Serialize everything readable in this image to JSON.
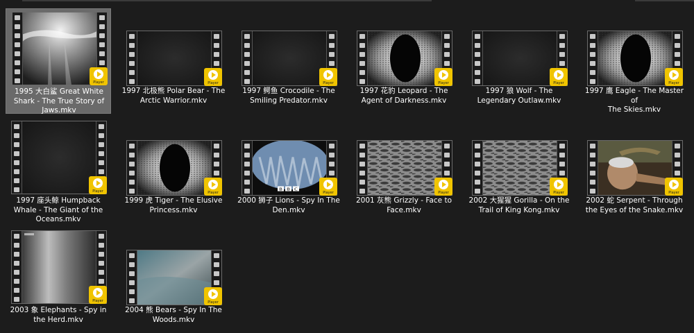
{
  "badge_text": "Player",
  "files": [
    {
      "name": "1995 大白鲨 Great White Shark - The True Story of Jaws.mkv",
      "lines": [
        "1995 大白鲨 Great White",
        "Shark - The True Story of",
        "Jaws.mkv"
      ],
      "thumb": "ocean-light",
      "selected": true
    },
    {
      "name": "1997 北极熊 Polar Bear - The Arctic Warrior.mkv",
      "lines": [
        "1997 北极熊 Polar Bear - The",
        "Arctic Warrior.mkv"
      ],
      "thumb": "dark"
    },
    {
      "name": "1997 鳄鱼 Crocodile - The Smiling Predator.mkv",
      "lines": [
        "1997 鳄鱼 Crocodile - The",
        "Smiling Predator.mkv"
      ],
      "thumb": "dark"
    },
    {
      "name": "1997 花豹 Leopard - The Agent of Darkness.mkv",
      "lines": [
        "1997 花豹 Leopard - The",
        "Agent of Darkness.mkv"
      ],
      "thumb": "eye"
    },
    {
      "name": "1997 狼 Wolf - The Legendary Outlaw.mkv",
      "lines": [
        "1997 狼 Wolf - The",
        "Legendary Outlaw.mkv"
      ],
      "thumb": "dark"
    },
    {
      "name": "1997 鹰 Eagle - The Master of The Skies.mkv",
      "lines": [
        "1997 鹰 Eagle - The Master of",
        "The Skies.mkv"
      ],
      "thumb": "eye"
    },
    {
      "name": "1997 座头鲸 Humpback Whale - The Giant of the Oceans.mkv",
      "lines": [
        "1997 座头鲸 Humpback",
        "Whale - The Giant of the",
        "Oceans.mkv"
      ],
      "thumb": "dark"
    },
    {
      "name": "1999 虎 Tiger - The Elusive Princess.mkv",
      "lines": [
        "1999 虎 Tiger - The Elusive",
        "Princess.mkv"
      ],
      "thumb": "eye"
    },
    {
      "name": "2000 狮子 Lions - Spy In The Den.mkv",
      "lines": [
        "2000 狮子 Lions - Spy In The",
        "Den.mkv"
      ],
      "thumb": "bbc"
    },
    {
      "name": "2001 灰熊 Grizzly - Face to Face.mkv",
      "lines": [
        "2001 灰熊 Grizzly - Face to",
        "Face.mkv"
      ],
      "thumb": "spots"
    },
    {
      "name": "2002 大猩猩 Gorilla - On the Trail of King Kong.mkv",
      "lines": [
        "2002 大猩猩 Gorilla - On the",
        "Trail of King Kong.mkv"
      ],
      "thumb": "spots"
    },
    {
      "name": "2002 蛇 Serpent - Through the Eyes of the Snake.mkv",
      "lines": [
        "2002 蛇 Serpent - Through",
        "the Eyes of the Snake.mkv"
      ],
      "thumb": "snake"
    },
    {
      "name": "2003 象 Elephants - Spy in the Herd.mkv",
      "lines": [
        "2003 象 Elephants - Spy in",
        "the Herd.mkv"
      ],
      "thumb": "grey"
    },
    {
      "name": "2004 熊 Bears - Spy In The Woods.mkv",
      "lines": [
        "2004 熊 Bears - Spy In The",
        "Woods.mkv"
      ],
      "thumb": "water"
    }
  ],
  "bbc_logo": "BBC"
}
